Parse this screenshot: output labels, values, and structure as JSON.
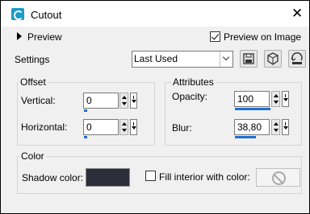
{
  "window": {
    "title": "Cutout",
    "close_symbol": "✕"
  },
  "preview": {
    "label": "Preview",
    "preview_on_image": {
      "label": "Preview on Image",
      "checked": true
    }
  },
  "settings": {
    "label": "Settings",
    "preset": "Last Used"
  },
  "toolbar": {
    "icons": [
      "save-preset-icon",
      "load-preset-icon",
      "reset-icon"
    ]
  },
  "offset": {
    "title": "Offset",
    "vertical": {
      "label": "Vertical:",
      "value": "0"
    },
    "horizontal": {
      "label": "Horizontal:",
      "value": "0"
    }
  },
  "attributes": {
    "title": "Attributes",
    "opacity": {
      "label": "Opacity:",
      "value": "100"
    },
    "blur": {
      "label": "Blur:",
      "value": "38,80"
    }
  },
  "color": {
    "title": "Color",
    "shadow_label": "Shadow color:",
    "shadow_color": "#2c2f3a",
    "fill_interior": {
      "label": "Fill interior with color:",
      "checked": false
    }
  },
  "colors": {
    "accent": "#1d6fd1",
    "brand": "#1a9bc9"
  }
}
